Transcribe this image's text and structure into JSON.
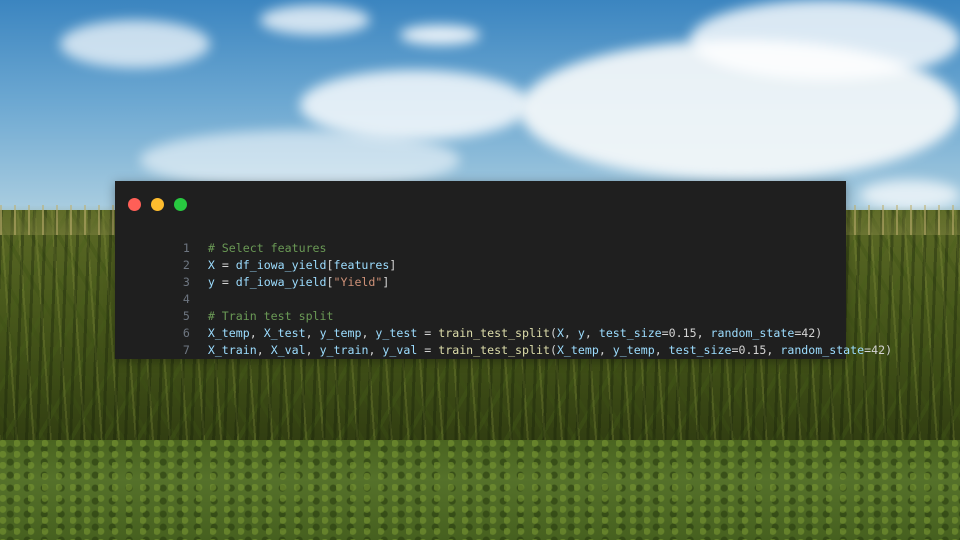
{
  "window": {
    "buttons": {
      "close_color": "#ff5f57",
      "minimize_color": "#febc2e",
      "maximize_color": "#28c840"
    }
  },
  "code": {
    "lines": [
      {
        "number": "1",
        "text": "# Select features"
      },
      {
        "number": "2",
        "text": "X = df_iowa_yield[features]"
      },
      {
        "number": "3",
        "text": "y = df_iowa_yield[\"Yield\"]"
      },
      {
        "number": "4",
        "text": ""
      },
      {
        "number": "5",
        "text": "# Train test split"
      },
      {
        "number": "6",
        "text": "X_temp, X_test, y_temp, y_test = train_test_split(X, y, test_size=0.15, random_state=42)"
      },
      {
        "number": "7",
        "text": "X_train, X_val, y_train, y_val = train_test_split(X_temp, y_temp, test_size=0.15, random_state=42)"
      }
    ]
  },
  "colors": {
    "editor_background": "#1f1f1f",
    "comment": "#6a9955",
    "variable": "#9cdcfe",
    "string": "#ce9178",
    "function": "#dcdcaa",
    "line_number": "#6e7681"
  }
}
